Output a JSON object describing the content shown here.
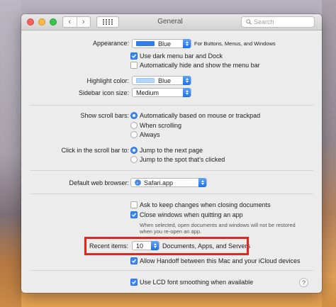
{
  "window": {
    "title": "General",
    "search_placeholder": "Search"
  },
  "appearance": {
    "label": "Appearance:",
    "value": "Blue",
    "value_color": "#2f7de8",
    "note": "For Buttons, Menus, and Windows",
    "dark_menu": "Use dark menu bar and Dock",
    "auto_hide": "Automatically hide and show the menu bar"
  },
  "highlight": {
    "label": "Highlight color:",
    "value": "Blue",
    "value_color": "#b3d7ff"
  },
  "sidebar_icon": {
    "label": "Sidebar icon size:",
    "value": "Medium"
  },
  "scroll_bars": {
    "label": "Show scroll bars:",
    "options": [
      "Automatically based on mouse or trackpad",
      "When scrolling",
      "Always"
    ]
  },
  "scroll_click": {
    "label": "Click in the scroll bar to:",
    "options": [
      "Jump to the next page",
      "Jump to the spot that's clicked"
    ]
  },
  "browser": {
    "label": "Default web browser:",
    "value": "Safari.app"
  },
  "documents": {
    "ask_keep": "Ask to keep changes when closing documents",
    "close_windows": "Close windows when quitting an app",
    "note_line1": "When selected, open documents and windows will not be restored",
    "note_line2": "when you re-open an app."
  },
  "recent": {
    "label": "Recent items:",
    "value": "10",
    "suffix": "Documents, Apps, and Servers"
  },
  "handoff": "Allow Handoff between this Mac and your iCloud devices",
  "lcd": "Use LCD font smoothing when available",
  "help_glyph": "?",
  "colors": {
    "accent": "#3a87f7",
    "callout": "#e3261c"
  }
}
